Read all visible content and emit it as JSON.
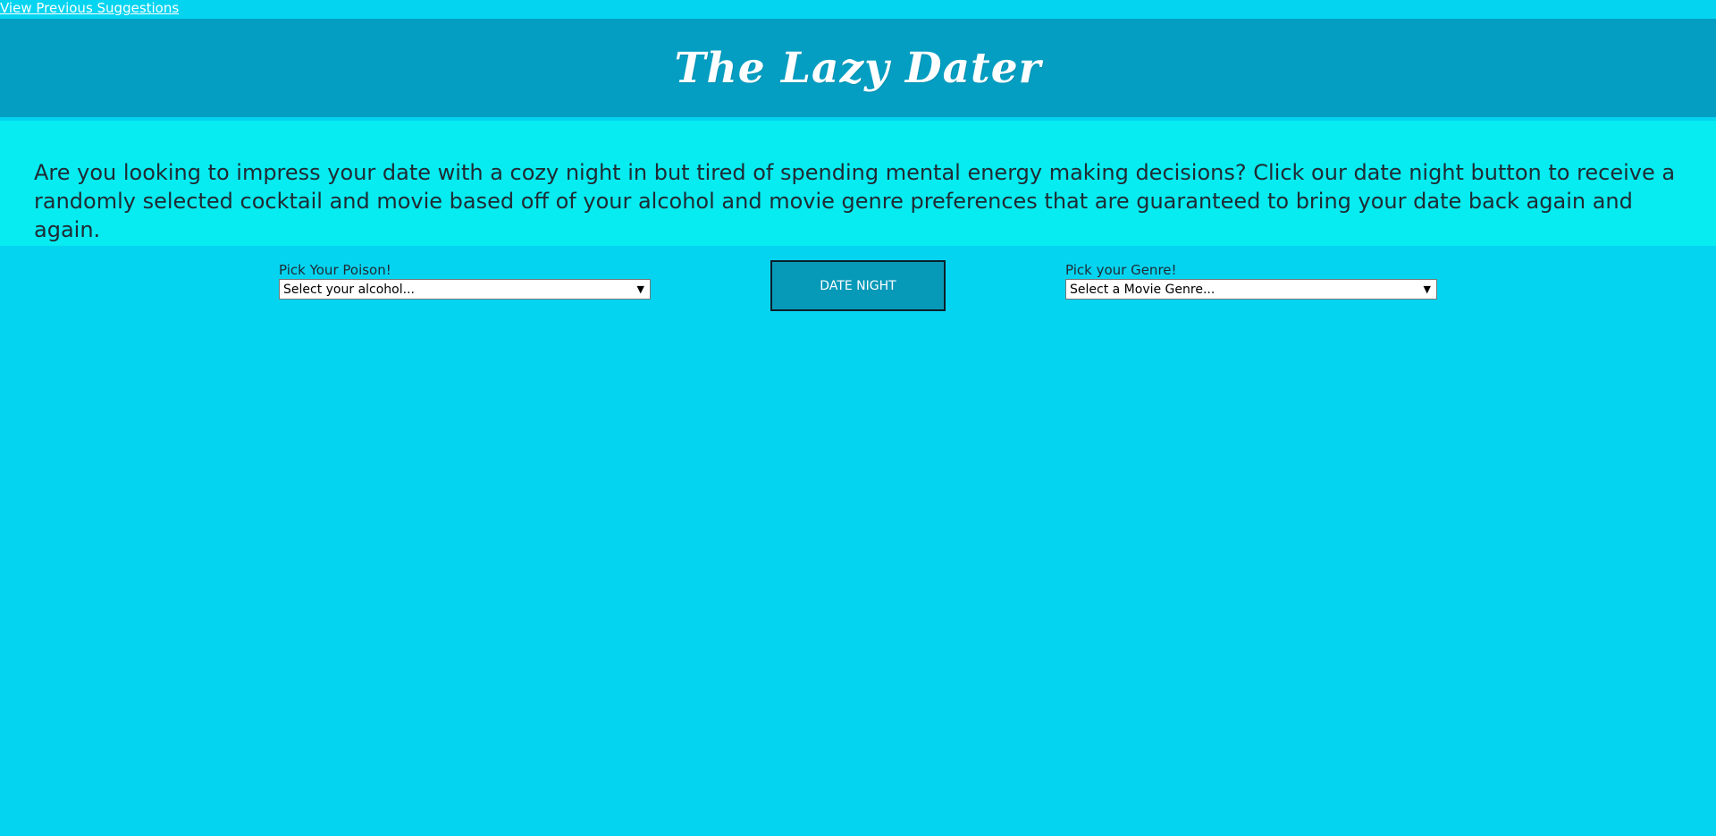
{
  "nav": {
    "previous_link": "View Previous Suggestions"
  },
  "header": {
    "title": "The Lazy Dater"
  },
  "intro": {
    "text": "Are you looking to impress your date with a cozy night in but tired of spending mental energy making decisions? Click our date night button to receive a randomly selected cocktail and movie based off of your alcohol and movie genre preferences that are guaranteed to bring your date back again and again."
  },
  "alcohol": {
    "label": "Pick Your Poison!",
    "selected": "Select your alcohol..."
  },
  "button": {
    "label": "DATE NIGHT"
  },
  "genre": {
    "label": "Pick your Genre!",
    "selected": "Select a Movie Genre..."
  },
  "colors": {
    "background": "#05d4f0",
    "header": "#049ec2",
    "intro": "#06ecf0",
    "button": "#0799b8"
  },
  "icons": {
    "select_arrow": "chevron-down-icon"
  }
}
